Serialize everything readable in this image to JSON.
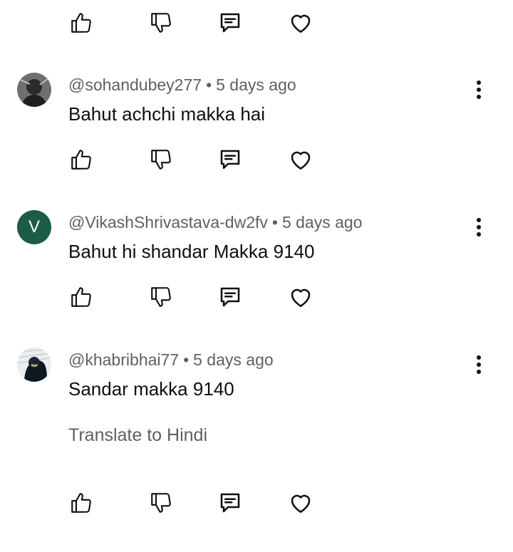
{
  "comments": [
    {
      "handle": "@sohandubey277",
      "time": "5 days ago",
      "text": "Bahut achchi makka hai",
      "avatar_type": "photo"
    },
    {
      "handle": "@VikashShrivastava-dw2fv",
      "time": "5 days ago",
      "text": "Bahut hi shandar Makka 9140",
      "avatar_letter": "V",
      "avatar_color": "#1c5b48"
    },
    {
      "handle": "@khabribhai77",
      "time": "5 days ago",
      "text": "Sandar makka 9140",
      "translate": "Translate to Hindi",
      "avatar_type": "photo"
    }
  ],
  "separator": "•",
  "icons": {
    "like": "thumbs-up-icon",
    "dislike": "thumbs-down-icon",
    "reply": "reply-icon",
    "heart": "heart-icon",
    "more": "more-vertical-icon"
  }
}
